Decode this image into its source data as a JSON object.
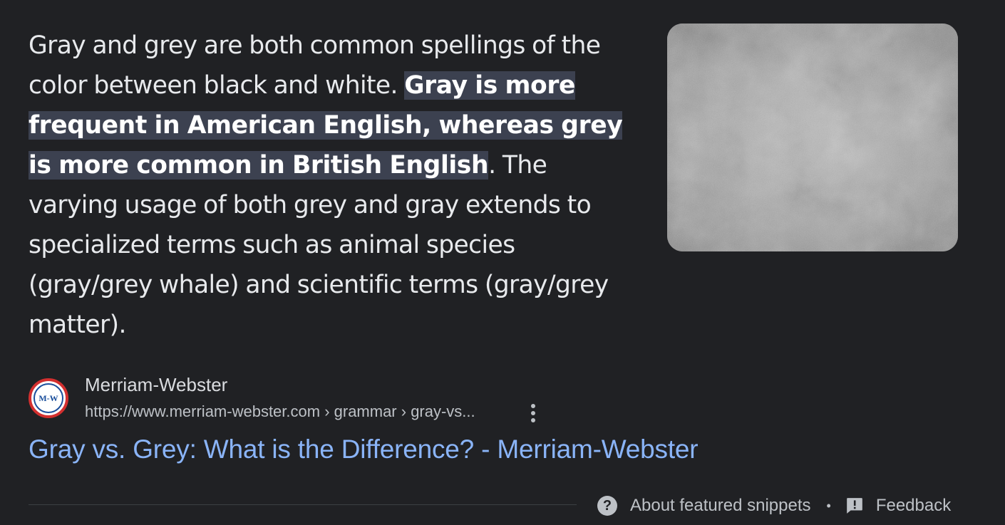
{
  "snippet": {
    "text_before": "Gray and grey are both common spellings of the color between black and white. ",
    "highlight": "Gray is more frequent in American English, whereas grey is more common in British English",
    "text_after": ". The varying usage of both grey and gray extends to specialized terms such as animal species (gray/grey whale) and scientific terms (gray/grey matter)."
  },
  "image": {
    "icon": "gray-texture-image"
  },
  "source": {
    "favicon_text": "M-W",
    "site_name": "Merriam-Webster",
    "url": "https://www.merriam-webster.com › grammar › gray-vs..."
  },
  "result": {
    "title": "Gray vs. Grey: What is the Difference? - Merriam-Webster"
  },
  "footer": {
    "about_label": "About featured snippets",
    "separator": "•",
    "feedback_label": "Feedback"
  },
  "colors": {
    "background": "#202124",
    "text": "#e8eaed",
    "highlight_bg": "#3c4150",
    "link": "#8ab4f8",
    "muted": "#bdc1c6"
  }
}
